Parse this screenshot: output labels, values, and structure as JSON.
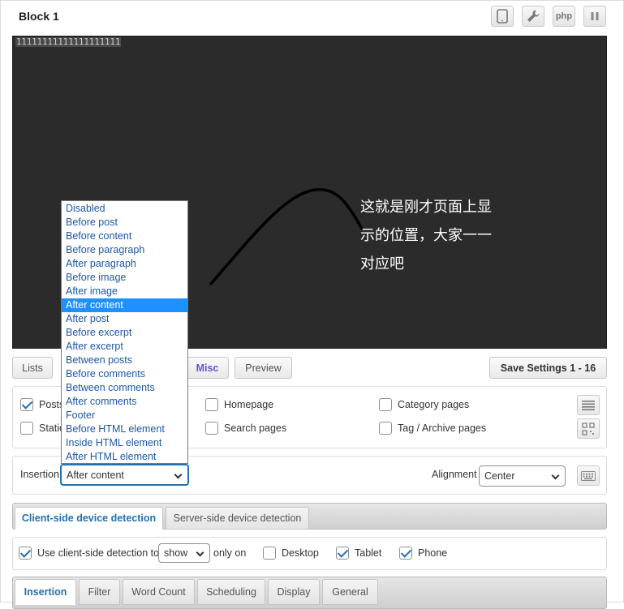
{
  "block": {
    "title": "Block 1",
    "toolbar": {
      "device_icon": "tablet-icon",
      "settings_icon": "wrench-icon",
      "php_label": "php",
      "pause_icon": "pause-icon"
    }
  },
  "editor": {
    "code": "11111111111111111111",
    "annotation_lines": [
      "这就是刚才页面上显",
      "示的位置，大家一一",
      "对应吧"
    ]
  },
  "buttons": {
    "lists": "Lists",
    "misc": "Misc",
    "preview": "Preview",
    "save": "Save Settings 1 - 16"
  },
  "pages": {
    "posts": {
      "label": "Posts",
      "checked": true
    },
    "static": {
      "label": "Static",
      "checked": false
    },
    "homepage": {
      "label": "Homepage",
      "checked": false
    },
    "search": {
      "label": "Search pages",
      "checked": false
    },
    "category": {
      "label": "Category pages",
      "checked": false
    },
    "tag": {
      "label": "Tag / Archive pages",
      "checked": false
    }
  },
  "insertion": {
    "label": "Insertion",
    "value": "After content",
    "options": [
      "Disabled",
      "Before post",
      "Before content",
      "Before paragraph",
      "After paragraph",
      "Before image",
      "After image",
      "After content",
      "After post",
      "Before excerpt",
      "After excerpt",
      "Between posts",
      "Before comments",
      "Between comments",
      "After comments",
      "Footer",
      "Before HTML element",
      "Inside HTML element",
      "After HTML element"
    ],
    "selected_index": 7
  },
  "alignment": {
    "label": "Alignment",
    "value": "Center"
  },
  "device_tabs": {
    "client": "Client-side device detection",
    "server": "Server-side device detection"
  },
  "client_detection": {
    "use_label": "Use client-side detection to",
    "use_checked": true,
    "mode": "show",
    "only_on": "only on",
    "desktop": {
      "label": "Desktop",
      "checked": false
    },
    "tablet": {
      "label": "Tablet",
      "checked": true
    },
    "phone": {
      "label": "Phone",
      "checked": true
    }
  },
  "bottom_tabs": [
    "Insertion",
    "Filter",
    "Word Count",
    "Scheduling",
    "Display",
    "General"
  ],
  "colors": {
    "accent": "#2271b1",
    "misc_accent": "#5b5bd6",
    "editor_bg": "#2b2b2b",
    "dropdown_highlight": "#1e90ff"
  }
}
